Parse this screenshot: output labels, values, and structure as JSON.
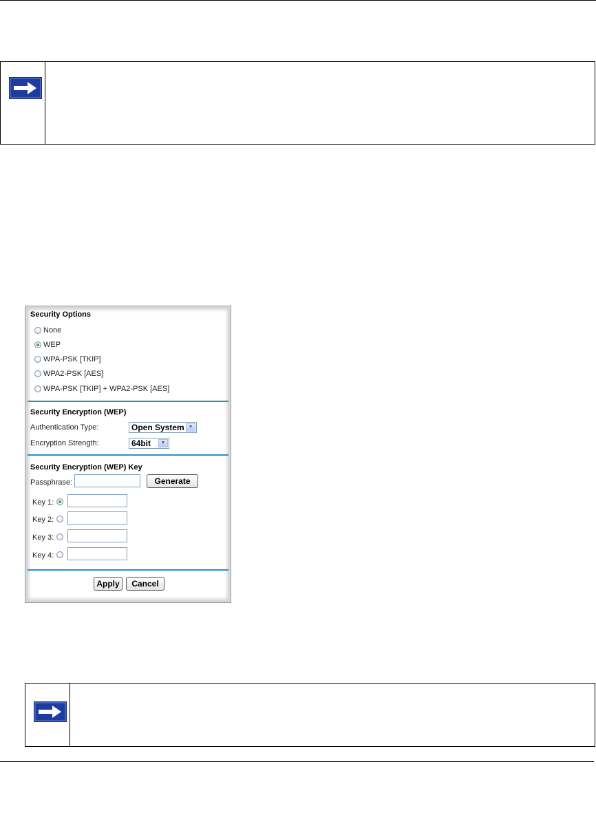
{
  "icons": {
    "note_arrow": "arrow-right-icon"
  },
  "colors": {
    "arrow_fill": "#1e3ba0",
    "separator": "#2b8fc4",
    "radio_checked": "#3caa3c"
  },
  "panel": {
    "security_options": {
      "title": "Security Options",
      "options": [
        {
          "label": "None",
          "checked": false
        },
        {
          "label": "WEP",
          "checked": true
        },
        {
          "label": "WPA-PSK [TKIP]",
          "checked": false
        },
        {
          "label": "WPA2-PSK [AES]",
          "checked": false
        },
        {
          "label": "WPA-PSK [TKIP] + WPA2-PSK [AES]",
          "checked": false
        }
      ]
    },
    "encryption": {
      "title": "Security Encryption (WEP)",
      "auth_label": "Authentication Type:",
      "auth_value": "Open System",
      "strength_label": "Encryption Strength:",
      "strength_value": "64bit"
    },
    "key_section": {
      "title": "Security Encryption (WEP) Key",
      "passphrase_label": "Passphrase:",
      "passphrase_value": "",
      "generate_label": "Generate",
      "keys": [
        {
          "label": "Key 1:",
          "selected": true,
          "value": ""
        },
        {
          "label": "Key 2:",
          "selected": false,
          "value": ""
        },
        {
          "label": "Key 3:",
          "selected": false,
          "value": ""
        },
        {
          "label": "Key 4:",
          "selected": false,
          "value": ""
        }
      ]
    },
    "apply_label": "Apply",
    "cancel_label": "Cancel"
  }
}
